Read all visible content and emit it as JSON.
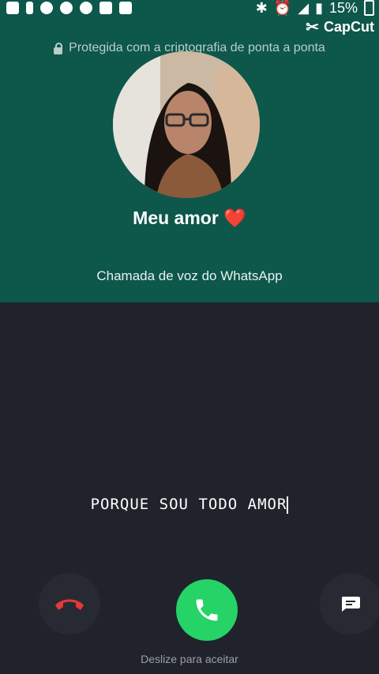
{
  "status_bar": {
    "battery": "15%"
  },
  "watermark": {
    "label": "CapCut"
  },
  "call": {
    "encryption_notice": "Protegida com a criptografia de ponta a ponta",
    "contact_name": "Meu amor",
    "contact_emoji": "❤️",
    "call_type": "Chamada de voz do WhatsApp"
  },
  "lyric_overlay": {
    "text": "PORQUE SOU TODO AMOR"
  },
  "actions": {
    "hint": "Deslize para aceitar"
  },
  "colors": {
    "header_bg": "#0d574b",
    "body_bg": "#20232b",
    "accept": "#25d366",
    "decline_icon": "#e53935"
  },
  "icons": {
    "status_left": [
      "notification-icon",
      "alert-icon",
      "whatsapp-icon",
      "missed-call-icon",
      "facebook-icon",
      "app-icon",
      "image-icon"
    ],
    "status_right": [
      "bluetooth-icon",
      "alarm-icon",
      "wifi-icon",
      "signal-icon",
      "battery-icon"
    ],
    "lock": "lock-icon",
    "decline": "phone-hangup-icon",
    "accept": "phone-icon",
    "message": "message-icon"
  }
}
